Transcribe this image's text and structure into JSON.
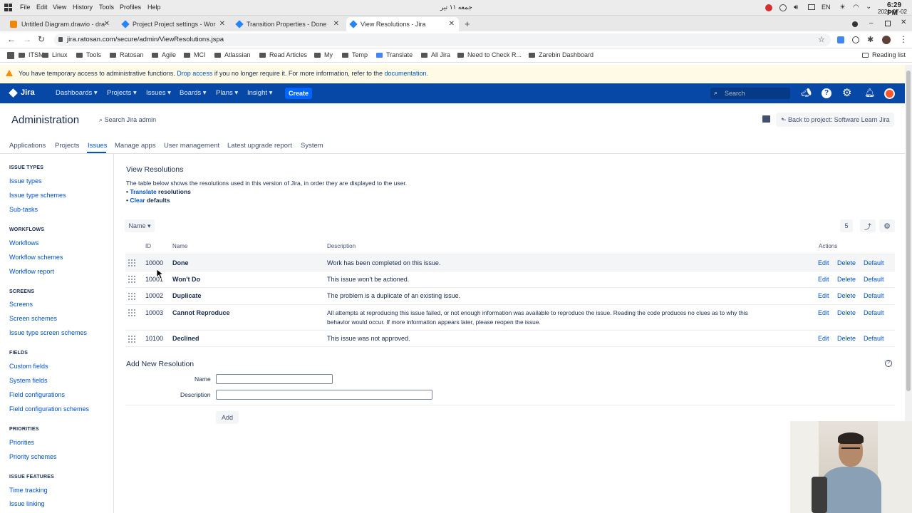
{
  "os": {
    "menu": [
      "File",
      "Edit",
      "View",
      "History",
      "Tools",
      "Profiles",
      "Help"
    ],
    "date_rtl": "جمعه ۱۱ تیر",
    "lang": "EN",
    "time": "6:29 PM",
    "date": "2021-07-02"
  },
  "browser": {
    "tabs": [
      {
        "label": "Untitled Diagram.drawio - dra",
        "color": "#f08705"
      },
      {
        "label": "Project Project settings - Wor",
        "color": "#2684ff"
      },
      {
        "label": "Transition Properties - Done",
        "color": "#2684ff"
      },
      {
        "label": "View Resolutions - Jira",
        "color": "#2684ff"
      }
    ],
    "url": "jira.ratosan.com/secure/admin/ViewResolutions.jspa",
    "bookmarks": [
      "ITSM",
      "Linux",
      "Tools",
      "Ratosan",
      "Agile",
      "MCI",
      "Atlassian",
      "Read Articles",
      "My",
      "Temp",
      "Translate",
      "All Jira",
      "Need to Check R...",
      "Zarebin Dashboard"
    ],
    "reading_list": "Reading list"
  },
  "warning": {
    "text_before": "You have temporary access to administrative functions.",
    "drop_link": "Drop access",
    "text_mid": "if you no longer require it. For more information, refer to the",
    "doc_link": "documentation."
  },
  "jira_nav": {
    "logo": "Jira",
    "items": [
      "Dashboards",
      "Projects",
      "Issues",
      "Boards",
      "Plans",
      "Insight"
    ],
    "create": "Create",
    "search_placeholder": "Search"
  },
  "admin": {
    "title": "Administration",
    "search": "Search Jira admin",
    "back": "Back to project: Software Learn Jira",
    "tabs": [
      "Applications",
      "Projects",
      "Issues",
      "Manage apps",
      "User management",
      "Latest upgrade report",
      "System"
    ],
    "active_tab": "Issues"
  },
  "sidebar": [
    {
      "heading": "ISSUE TYPES",
      "items": [
        "Issue types",
        "Issue type schemes",
        "Sub-tasks"
      ]
    },
    {
      "heading": "WORKFLOWS",
      "items": [
        "Workflows",
        "Workflow schemes",
        "Workflow report"
      ]
    },
    {
      "heading": "SCREENS",
      "items": [
        "Screens",
        "Screen schemes",
        "Issue type screen schemes"
      ]
    },
    {
      "heading": "FIELDS",
      "items": [
        "Custom fields",
        "System fields",
        "Field configurations",
        "Field configuration schemes"
      ]
    },
    {
      "heading": "PRIORITIES",
      "items": [
        "Priorities",
        "Priority schemes"
      ]
    },
    {
      "heading": "ISSUE FEATURES",
      "items": [
        "Time tracking",
        "Issue linking"
      ]
    }
  ],
  "page": {
    "heading": "View Resolutions",
    "intro": "The table below shows the resolutions used in this version of Jira, in order they are displayed to the user.",
    "link1_a": "Translate",
    "link1_b": "resolutions",
    "link2_a": "Clear",
    "link2_b": "defaults",
    "sort_label": "Name",
    "count": "5",
    "columns": {
      "id": "ID",
      "name": "Name",
      "description": "Description",
      "actions": "Actions"
    },
    "rows": [
      {
        "id": "10000",
        "name": "Done",
        "description": "Work has been completed on this issue.",
        "description2": ""
      },
      {
        "id": "10001",
        "name": "Won't Do",
        "description": "This issue won't be actioned.",
        "description2": ""
      },
      {
        "id": "10002",
        "name": "Duplicate",
        "description": "The problem is a duplicate of an existing issue.",
        "description2": ""
      },
      {
        "id": "10003",
        "name": "Cannot Reproduce",
        "description": "All attempts at reproducing this issue failed, or not enough information was available to reproduce the issue. Reading the code produces no clues as to why this",
        "description2": "behavior would occur. If more information appears later, please reopen the issue."
      },
      {
        "id": "10100",
        "name": "Declined",
        "description": "This issue was not approved.",
        "description2": ""
      }
    ],
    "actions": [
      "Edit",
      "Delete",
      "Default"
    ],
    "add_heading": "Add New Resolution",
    "name_label": "Name",
    "desc_label": "Description",
    "add_button": "Add"
  }
}
